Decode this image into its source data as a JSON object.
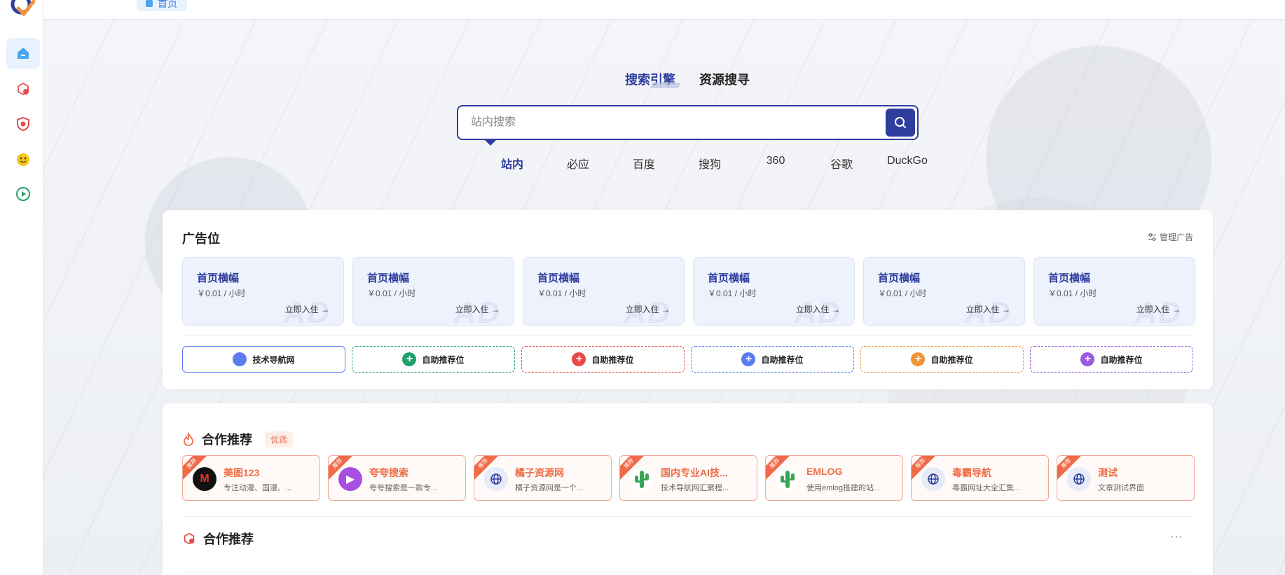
{
  "topbar": {
    "home_tab_label": "首页"
  },
  "search": {
    "tabs": [
      {
        "label": "搜索引擎",
        "active": true
      },
      {
        "label": "资源搜寻",
        "active": false
      }
    ],
    "placeholder": "站内搜索",
    "engines": [
      {
        "label": "站内",
        "active": true
      },
      {
        "label": "必应",
        "active": false
      },
      {
        "label": "百度",
        "active": false
      },
      {
        "label": "搜狗",
        "active": false
      },
      {
        "label": "360",
        "active": false
      },
      {
        "label": "谷歌",
        "active": false
      },
      {
        "label": "DuckGo",
        "active": false
      }
    ]
  },
  "ads": {
    "title": "广告位",
    "manage_label": "管理广告",
    "items": [
      {
        "title": "首页横幅",
        "price": "￥0.01 / 小时",
        "cta": "立即入住 →",
        "watermark": "AD"
      },
      {
        "title": "首页横幅",
        "price": "￥0.01 / 小时",
        "cta": "立即入住 →",
        "watermark": "AD"
      },
      {
        "title": "首页横幅",
        "price": "￥0.01 / 小时",
        "cta": "立即入住 →",
        "watermark": "AD"
      },
      {
        "title": "首页横幅",
        "price": "￥0.01 / 小时",
        "cta": "立即入住 →",
        "watermark": "AD"
      },
      {
        "title": "首页横幅",
        "price": "￥0.01 / 小时",
        "cta": "立即入住 →",
        "watermark": "AD"
      },
      {
        "title": "首页横幅",
        "price": "￥0.01 / 小时",
        "cta": "立即入住 →",
        "watermark": "AD"
      }
    ],
    "self_slots": [
      {
        "label": "技术导航网",
        "color": "#5b7cf0",
        "style": "solid",
        "icon": ""
      },
      {
        "label": "自助推荐位",
        "color": "#22a06b",
        "style": "dashed",
        "icon": "+"
      },
      {
        "label": "自助推荐位",
        "color": "#e84a4a",
        "style": "dashed",
        "icon": "+"
      },
      {
        "label": "自助推荐位",
        "color": "#5b7cf0",
        "style": "dashed",
        "icon": "+"
      },
      {
        "label": "自助推荐位",
        "color": "#f0953a",
        "style": "dashed",
        "icon": "+"
      },
      {
        "label": "自助推荐位",
        "color": "#9b5ae0",
        "style": "dashed",
        "icon": "+"
      }
    ]
  },
  "coop": {
    "title": "合作推荐",
    "badge": "优选",
    "ribbon_label": "推荐",
    "items": [
      {
        "name": "美图123",
        "desc": "专注动漫、国漫、...",
        "icon": "M",
        "icon_bg": "#111111",
        "icon_color": "#e8322b"
      },
      {
        "name": "夸夸搜索",
        "desc": "夸夸搜索是一款专...",
        "icon": "▶",
        "icon_bg": "#a64fe0",
        "icon_color": "#ffffff"
      },
      {
        "name": "橘子资源网",
        "desc": "橘子资源网是一个...",
        "icon": "globe",
        "icon_bg": "#e7ebf8",
        "icon_color": "#2f3e9e"
      },
      {
        "name": "国内专业AI技...",
        "desc": "技术导航网汇聚程...",
        "icon": "cactus",
        "icon_bg": "#ffffff",
        "icon_color": "#3aa655"
      },
      {
        "name": "EMLOG",
        "desc": "使用emlog搭建的站...",
        "icon": "cactus",
        "icon_bg": "#ffffff",
        "icon_color": "#3aa655"
      },
      {
        "name": "毒霸导航",
        "desc": "毒霸网址大全汇集...",
        "icon": "globe",
        "icon_bg": "#e7ebf8",
        "icon_color": "#2f3e9e"
      },
      {
        "name": "测试",
        "desc": "文章测试界面",
        "icon": "globe",
        "icon_bg": "#e7ebf8",
        "icon_color": "#2f3e9e"
      }
    ],
    "second_title": "合作推荐",
    "more_label": "···"
  }
}
